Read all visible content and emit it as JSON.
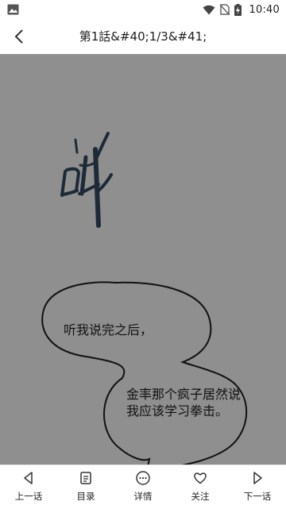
{
  "status_bar": {
    "time": "10:40"
  },
  "header": {
    "title": "第1話&#40;1/3&#41;"
  },
  "comic": {
    "sfx": "呲",
    "bubble_1": "听我说完之后，",
    "bubble_2": "金率那个疯子居然说我应该学习拳击。"
  },
  "bottom_nav": {
    "items": [
      {
        "label": "上一话",
        "icon": "previous-icon"
      },
      {
        "label": "目录",
        "icon": "catalog-icon"
      },
      {
        "label": "详情",
        "icon": "more-icon"
      },
      {
        "label": "关注",
        "icon": "heart-icon"
      },
      {
        "label": "下一话",
        "icon": "next-icon"
      }
    ]
  },
  "colors": {
    "viewer_bg": "#8f8f8f",
    "bar_bg": "#ffffff",
    "text": "#222222"
  }
}
